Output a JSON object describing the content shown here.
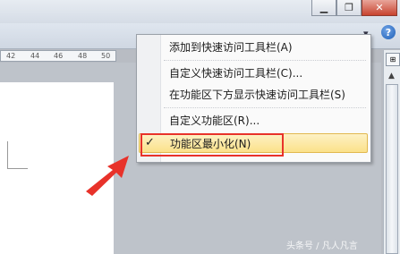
{
  "window": {
    "minimize_symbol": "▁",
    "restore_symbol": "❐",
    "close_symbol": "✕",
    "help_symbol": "?",
    "qat_dropdown_symbol": "▾"
  },
  "ruler": {
    "ticks": [
      "42",
      "44",
      "46",
      "48",
      "50"
    ]
  },
  "context_menu": {
    "items": [
      {
        "label": "添加到快速访问工具栏(A)",
        "checked": false
      },
      {
        "label": "自定义快速访问工具栏(C)...",
        "checked": false
      },
      {
        "label": "在功能区下方显示快速访问工具栏(S)",
        "checked": false
      },
      {
        "label": "自定义功能区(R)...",
        "checked": false
      },
      {
        "label": "功能区最小化(N)",
        "checked": true
      }
    ],
    "check_mark": "✓"
  },
  "scrollbar": {
    "top_icon": "⊞",
    "arrow": "▲"
  },
  "watermark": "头条号 / 凡人凡言",
  "colors": {
    "highlight_box": "#e8322a",
    "annotation_arrow": "#e8322a",
    "selected_item_bg": "#fbe18a"
  }
}
